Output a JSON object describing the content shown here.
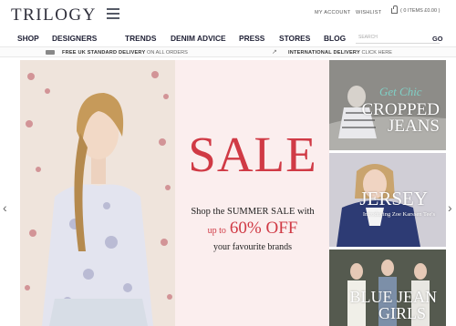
{
  "header": {
    "logo": "TRILOGY",
    "my_account": "MY ACCOUNT",
    "wishlist": "WISHLIST",
    "cart": "( 0 ITEMS £0.00 )"
  },
  "nav": {
    "items": [
      "SHOP",
      "DESIGNERS",
      "TRENDS",
      "DENIM ADVICE",
      "PRESS",
      "STORES",
      "BLOG"
    ],
    "search_placeholder": "SEARCH",
    "go": "GO"
  },
  "delivery": {
    "uk_bold": "FREE UK STANDARD DELIVERY",
    "uk_rest": "ON ALL ORDERS",
    "intl_bold": "INTERNATIONAL DELIVERY",
    "intl_link": "CLICK HERE"
  },
  "hero": {
    "title": "SALE",
    "line1": "Shop the SUMMER SALE with",
    "line2_prefix": "up to",
    "line2_big": "60% OFF",
    "line3": "your favourite brands"
  },
  "tiles": [
    {
      "sub": "Get Chic",
      "title_1": "CROPPED",
      "title_2": "JEANS"
    },
    {
      "title_1": "JERSEY",
      "sub": "Introducing Zoe Karssen Tee's"
    },
    {
      "title_1": "BLUE JEAN",
      "title_2": "GIRLS"
    }
  ],
  "colors": {
    "accent": "#d03a45",
    "nav_text": "#1f2035",
    "hero_bg": "#fbeeee",
    "tile_script": "#7fd0c6"
  },
  "icons": [
    "menu-icon",
    "cart-icon",
    "truck-icon",
    "arrow-icon",
    "chevron-left-icon",
    "chevron-right-icon"
  ]
}
